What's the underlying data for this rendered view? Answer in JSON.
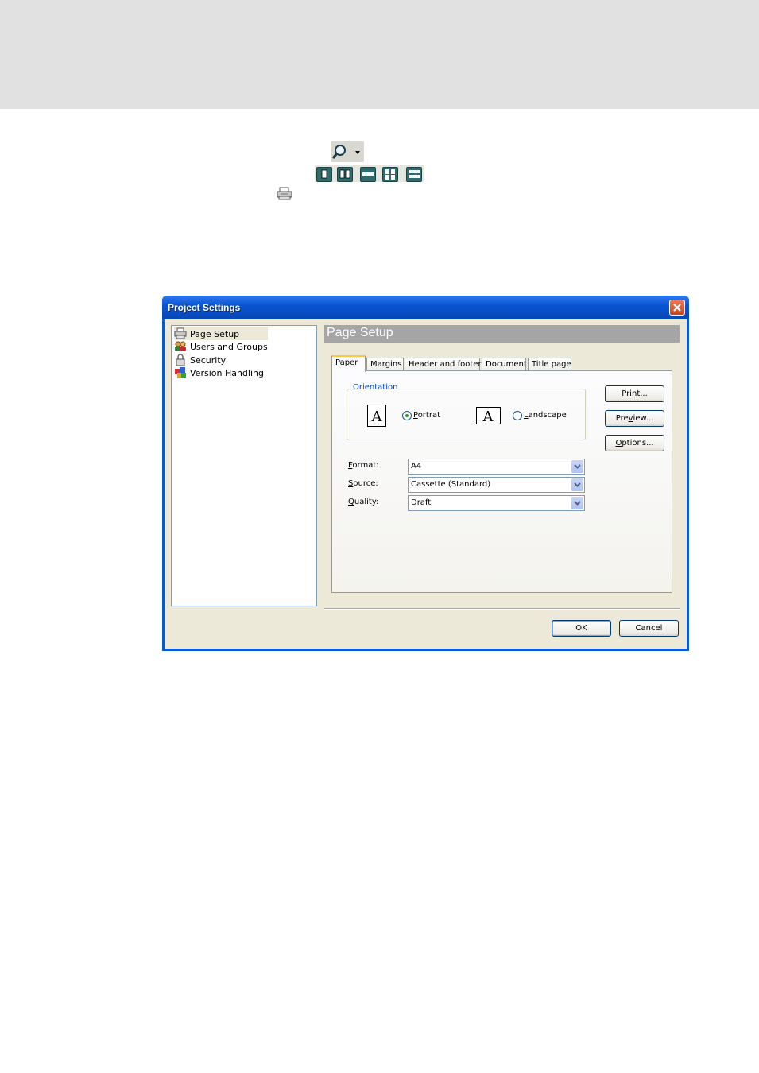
{
  "toolbar": {
    "zoom_icon": "magnifier-icon",
    "view_icons": [
      "single-page-icon",
      "two-page-icon",
      "three-page-row-icon",
      "four-page-icon",
      "six-page-icon"
    ],
    "print_icon": "printer-icon"
  },
  "dialog": {
    "title": "Project Settings",
    "tree": [
      {
        "label": "Page Setup",
        "icon": "printer-icon",
        "selected": true
      },
      {
        "label": "Users and Groups",
        "icon": "users-icon"
      },
      {
        "label": "Security",
        "icon": "lock-icon"
      },
      {
        "label": "Version Handling",
        "icon": "version-icon"
      }
    ],
    "page_header": "Page Setup",
    "tabs": [
      "Paper",
      "Margins",
      "Header and footer",
      "Document",
      "Title page"
    ],
    "active_tab": "Paper",
    "orientation": {
      "legend": "Orientation",
      "portrait_label_u": "P",
      "portrait_label_rest": "ortrat",
      "landscape_label_u": "L",
      "landscape_label_rest": "andscape",
      "selected": "Portrat"
    },
    "side_buttons": {
      "print_u": "Pri",
      "print_k": "n",
      "print_rest": "t...",
      "preview_u": "Pre",
      "preview_k": "v",
      "preview_rest": "iew...",
      "options_k": "O",
      "options_rest": "ptions..."
    },
    "fields": {
      "format_k": "F",
      "format_rest": "ormat:",
      "format_value": "A4",
      "source_k": "S",
      "source_rest": "ource:",
      "source_value": "Cassette (Standard)",
      "quality_k": "Q",
      "quality_rest": "uality:",
      "quality_value": "Draft"
    },
    "ok_label": "OK",
    "cancel_label": "Cancel",
    "orientation_glyph": "A"
  }
}
